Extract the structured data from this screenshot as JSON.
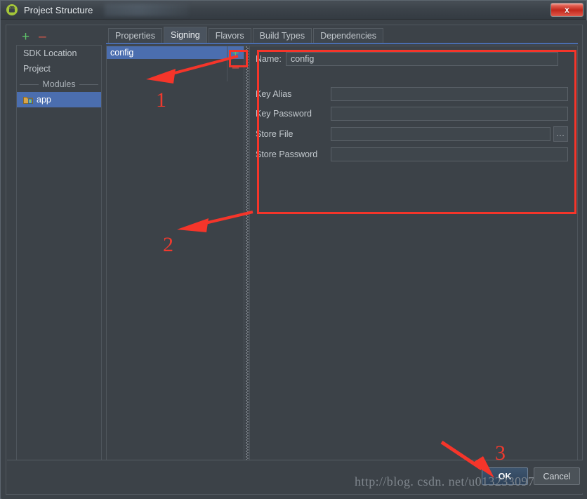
{
  "window": {
    "title": "Project Structure",
    "app_icon": "android-icon",
    "close_label": "x"
  },
  "left_toolbar": {
    "add_label": "+",
    "remove_label": "–"
  },
  "sidebar": {
    "items": [
      {
        "label": "SDK Location",
        "type": "item",
        "selected": false
      },
      {
        "label": "Project",
        "type": "item",
        "selected": false
      },
      {
        "label": "Modules",
        "type": "separator"
      },
      {
        "label": "app",
        "type": "module",
        "selected": true,
        "icon": "module-folder-icon"
      }
    ]
  },
  "tabs": [
    {
      "label": "Properties",
      "active": false
    },
    {
      "label": "Signing",
      "active": true
    },
    {
      "label": "Flavors",
      "active": false
    },
    {
      "label": "Build Types",
      "active": false
    },
    {
      "label": "Dependencies",
      "active": false
    }
  ],
  "config_list": {
    "items": [
      {
        "label": "config",
        "selected": true
      }
    ],
    "add_label": "+",
    "remove_label": "–"
  },
  "form": {
    "name_label": "Name:",
    "name_value": "config",
    "fields": [
      {
        "label": "Key Alias",
        "value": "",
        "browse": false
      },
      {
        "label": "Key Password",
        "value": "",
        "browse": false
      },
      {
        "label": "Store File",
        "value": "",
        "browse": true,
        "browse_label": "..."
      },
      {
        "label": "Store Password",
        "value": "",
        "browse": false
      }
    ]
  },
  "footer": {
    "ok_label": "OK",
    "cancel_label": "Cancel"
  },
  "annotations": {
    "marker1": "1",
    "marker2": "2",
    "marker3": "3",
    "accent_color": "#f5352a"
  },
  "watermark": "http://blog. csdn. net/u013233097"
}
